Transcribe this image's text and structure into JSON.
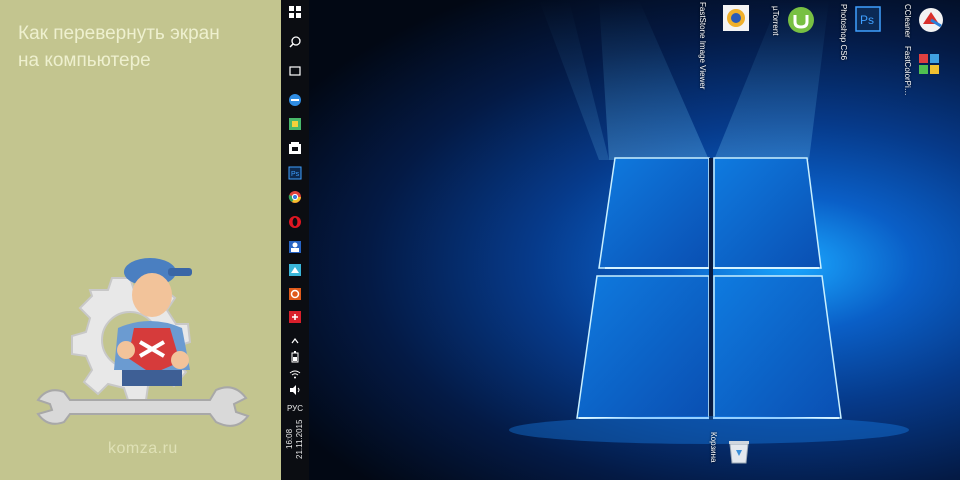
{
  "article": {
    "title_line1": "Как перевернуть экран",
    "title_line2": "на компьютере",
    "site": "komza.ru"
  },
  "taskbar": {
    "icons": [
      "start-icon",
      "cortana-icon",
      "task-view-icon",
      "edge-icon",
      "store-icon",
      "app-icon",
      "photoshop-icon",
      "chrome-icon",
      "opera-icon",
      "app-icon",
      "app-icon",
      "ccleaner-icon",
      "app-icon"
    ],
    "language": "РУС",
    "time": "16:08",
    "date": "21.11.2015"
  },
  "desktop": {
    "icons": [
      {
        "label": "FastStone Image Viewer",
        "icon": "faststone-icon"
      },
      {
        "label": "µTorrent",
        "icon": "utorrent-icon"
      },
      {
        "label": "Photoshop CS6",
        "icon": "photoshop-icon"
      },
      {
        "label": "CCleaner",
        "icon": "ccleaner-icon"
      },
      {
        "label": "FastColorPi…",
        "icon": "colorpicker-icon"
      },
      {
        "label": "Корзина",
        "icon": "recycle-bin-icon"
      }
    ]
  },
  "colors": {
    "panel_bg": "#c3c58f",
    "taskbar_bg": "#0b0d12",
    "desktop_glow": "#1aa7ff"
  }
}
